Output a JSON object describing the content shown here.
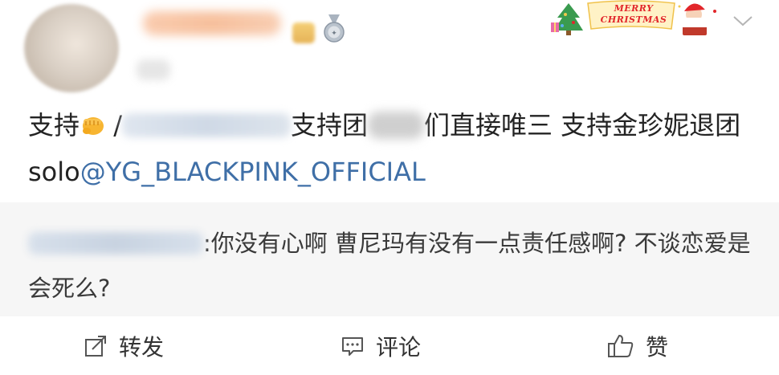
{
  "header": {
    "decoration": {
      "line1": "MERRY",
      "line2": "CHRISTMAS"
    }
  },
  "post": {
    "segments": [
      {
        "text": "支持"
      },
      {
        "text": " /"
      },
      {
        "text": "支持团"
      },
      {
        "text": "们直接唯三 支持金珍妮退团 solo"
      },
      {
        "text": "@YG_BLACKPINK_OFFICIAL"
      }
    ]
  },
  "comment": {
    "text": ":你没有心啊 曹尼玛有没有一点责任感啊? 不谈恋爱是会死么?"
  },
  "actions": {
    "repost": "转发",
    "comment": "评论",
    "like": "赞"
  },
  "colors": {
    "mention": "#3f6fa7",
    "quote_background": "#f6f6f6",
    "text": "#232323"
  },
  "icons": {
    "fist": "oncoming-fist-emoji",
    "medal": "medal-badge-icon",
    "chevron": "chevron-down-icon",
    "repost": "share-arrow-icon",
    "comment": "comment-bubble-icon",
    "like": "thumbs-up-icon"
  }
}
